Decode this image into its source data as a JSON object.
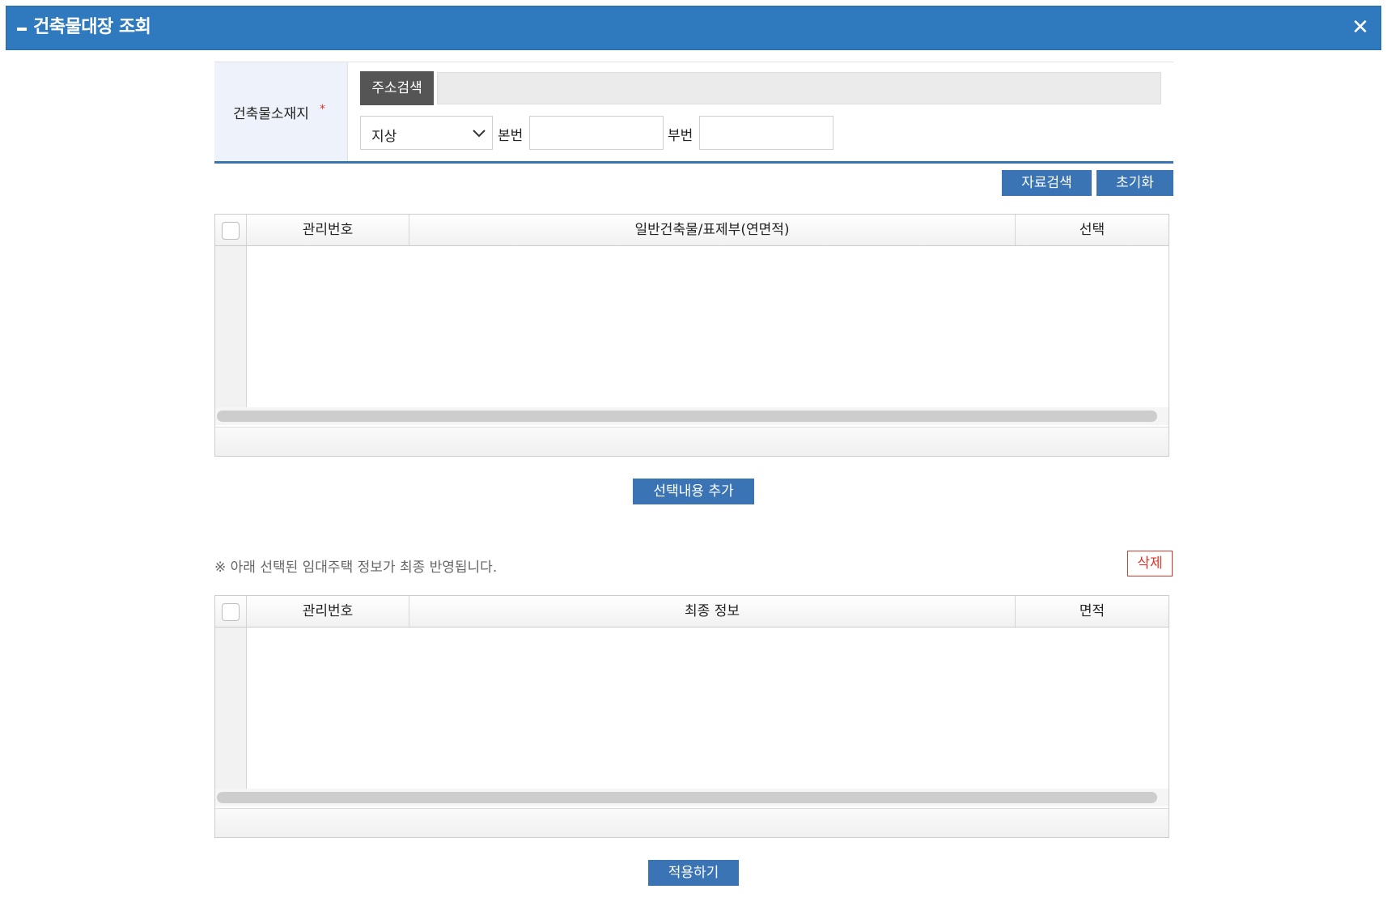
{
  "header": {
    "title": "건축물대장 조회",
    "close_symbol": "✕",
    "collapse_icon": "minus-icon",
    "bg_color": "#2f7abf"
  },
  "form": {
    "location_label": "건축물소재지",
    "required_mark": "*",
    "address_search_button": "주소검색",
    "address_value": "",
    "land_type_selected": "지상",
    "main_number_label": "본번",
    "main_number_value": "",
    "sub_number_label": "부번",
    "sub_number_value": ""
  },
  "actions": {
    "search_button": "자료검색",
    "reset_button": "초기화",
    "add_selected_button": "선택내용 추가",
    "apply_button": "적용하기",
    "delete_button": "삭제"
  },
  "search_grid": {
    "columns": [
      "관리번호",
      "일반건축물/표제부(연면적)",
      "선택"
    ],
    "rows": []
  },
  "notice": "※ 아래 선택된 임대주택 정보가 최종 반영됩니다.",
  "result_grid": {
    "columns": [
      "관리번호",
      "최종 정보",
      "면적"
    ],
    "rows": []
  },
  "colors": {
    "accent": "#3a74b4",
    "danger": "#d9362b",
    "label_bg": "#eef3fb"
  }
}
